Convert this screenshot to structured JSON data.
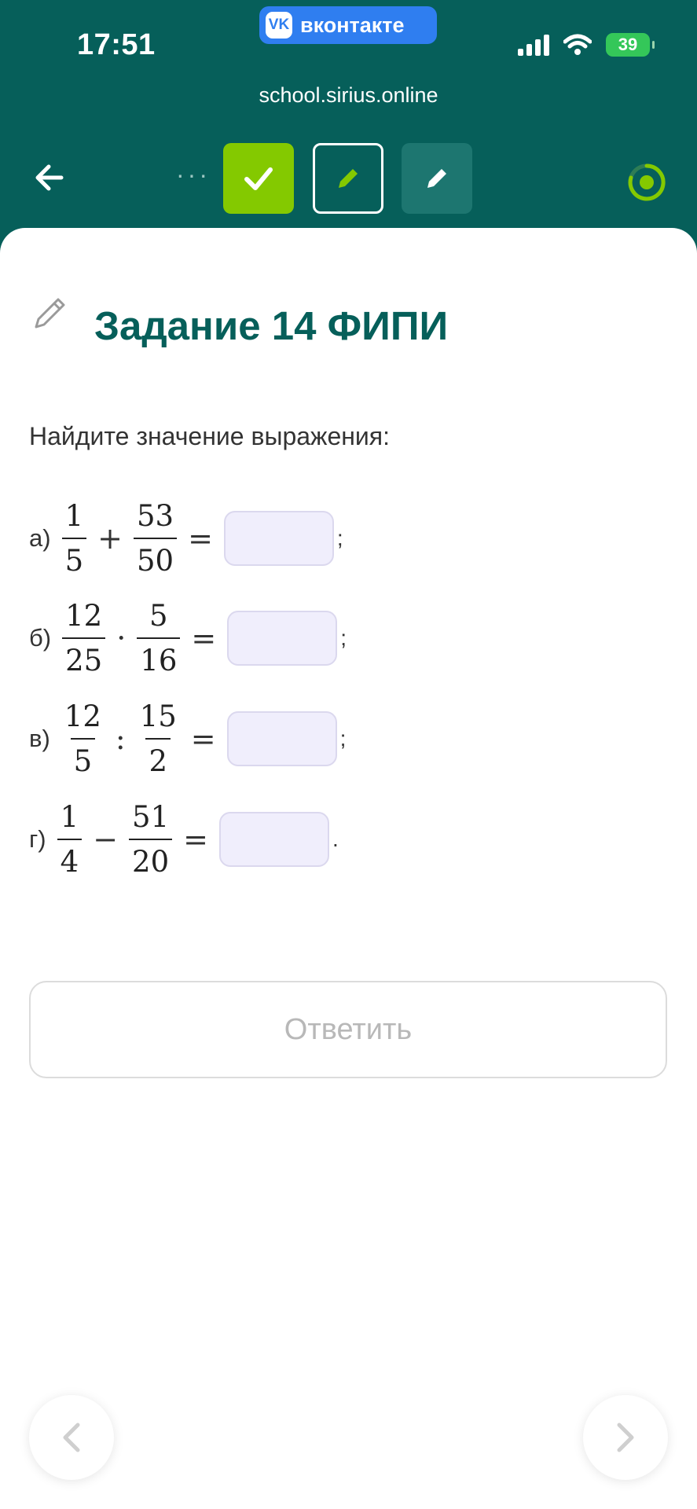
{
  "status_bar": {
    "time": "17:51",
    "vk_label": "вконтакте",
    "vk_logo": "VK",
    "battery": "39"
  },
  "browser": {
    "url": "school.sirius.online"
  },
  "task": {
    "title": "Задание 14 ФИПИ",
    "prompt": "Найдите значение выражения:",
    "rows": [
      {
        "label": "а)",
        "a_num": "1",
        "a_den": "5",
        "op": "+",
        "b_num": "53",
        "b_den": "50",
        "eq": "=",
        "end": ";"
      },
      {
        "label": "б)",
        "a_num": "12",
        "a_den": "25",
        "op": "·",
        "b_num": "5",
        "b_den": "16",
        "eq": "=",
        "end": ";"
      },
      {
        "label": "в)",
        "a_num": "12",
        "a_den": "5",
        "op": ":",
        "b_num": "15",
        "b_den": "2",
        "eq": "=",
        "end": ";"
      },
      {
        "label": "г)",
        "a_num": "1",
        "a_den": "4",
        "op": "−",
        "b_num": "51",
        "b_den": "20",
        "eq": "=",
        "end": "."
      }
    ],
    "submit_label": "Ответить"
  },
  "icons": {
    "back": "arrow-left-icon",
    "done": "check-icon",
    "current": "pencil-icon",
    "progress": "progress-ring-icon"
  },
  "colors": {
    "header": "#065f5a",
    "accent_green": "#84c900",
    "title": "#065f5a",
    "input_bg": "#f0eefc"
  }
}
